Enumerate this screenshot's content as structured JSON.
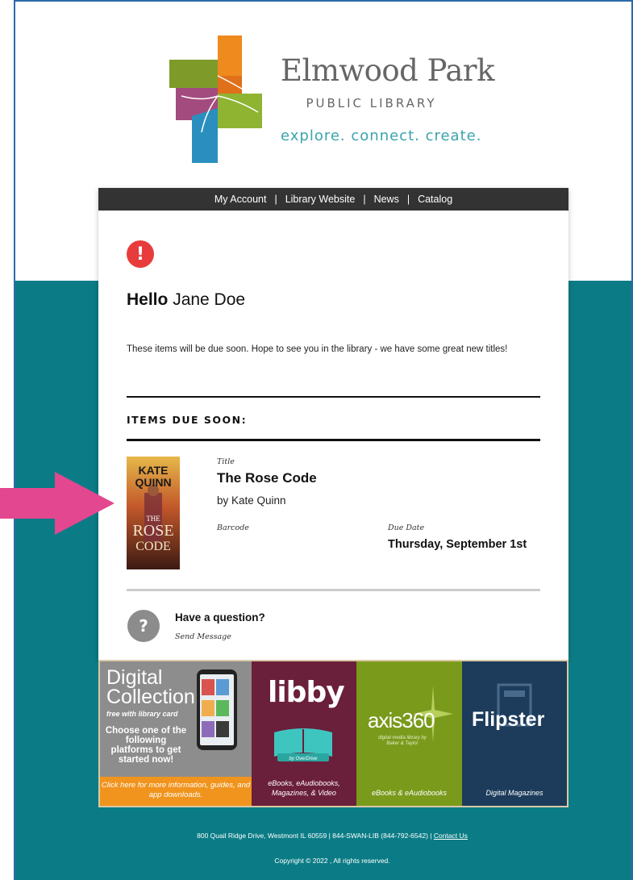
{
  "logo": {
    "name": "Elmwood Park",
    "subtitle": "PUBLIC LIBRARY",
    "tagline": "explore. connect. create."
  },
  "nav": {
    "items": [
      "My Account",
      "Library Website",
      "News",
      "Catalog"
    ],
    "separator": "|"
  },
  "greeting": {
    "hello": "Hello",
    "name": "Jane Doe"
  },
  "intro": "These items will be due soon. Hope to see you in the library - we have some great new titles!",
  "section_heading": "ITEMS DUE SOON:",
  "item": {
    "cover": {
      "author_top": "KATE",
      "author_bottom": "QUINN",
      "title_1": "THE",
      "title_2": "ROSE",
      "title_3": "CODE"
    },
    "title_label": "Title",
    "title": "The Rose Code",
    "author": "by Kate Quinn",
    "barcode_label": "Barcode",
    "due_label": "Due Date",
    "due_date": "Thursday, September 1st"
  },
  "question": {
    "icon_glyph": "?",
    "title": "Have a question?",
    "link": "Send Message"
  },
  "banner": {
    "digital": {
      "heading_1": "Digital",
      "heading_2": "Collection",
      "free": "free with library card",
      "choose": "Choose one of the following platforms to get started now!",
      "footer": "Click here for more information, guides, and app downloads."
    },
    "libby": {
      "word": "libby",
      "by": "by OverDrive",
      "caption": "eBooks, eAudiobooks, Magazines, & Video"
    },
    "axis": {
      "word": "axis360",
      "sub": "digital media library by Baker & Taylor",
      "caption": "eBooks & eAudiobooks"
    },
    "flipster": {
      "word": "Flipster",
      "caption": "Digital Magazines"
    }
  },
  "footer": {
    "address": "800 Quail Ridge Drive, Westmont IL 60559 | 844-SWAN-LIB (844-792-6542) |",
    "contact": "Contact Us",
    "copyright": "Copyright © 2022 , All rights reserved."
  },
  "colors": {
    "teal": "#0b7c86",
    "nav": "#333333",
    "alert": "#e83c3c",
    "arrow": "#e2478f",
    "tagline": "#3aa3ad"
  },
  "icons": {
    "alert": "exclamation-circle-icon",
    "question": "question-circle-icon",
    "arrow": "right-arrow-icon"
  }
}
